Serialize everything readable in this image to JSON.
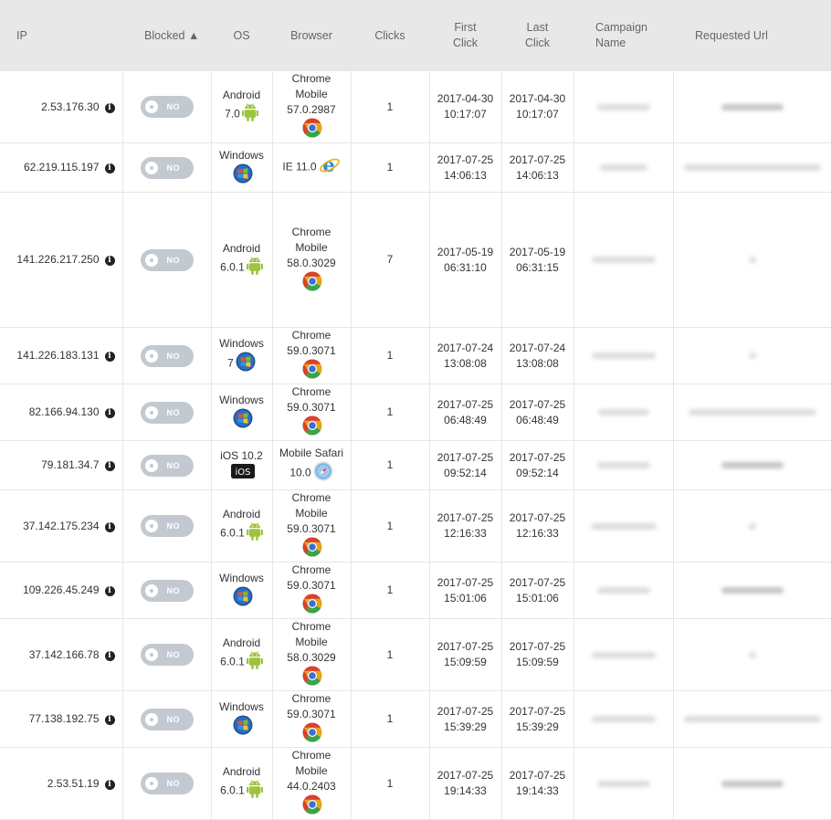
{
  "headers": {
    "ip": "IP",
    "blocked": "Blocked ▲",
    "os": "OS",
    "browser": "Browser",
    "clicks": "Clicks",
    "first_click": "First Click",
    "last_click": "Last Click",
    "campaign_name": "Campaign Name",
    "requested_url": "Requested Url"
  },
  "toggle_label": "NO",
  "info_icon_glyph": "i",
  "rows": [
    {
      "ip": "2.53.176.30",
      "os_name": "Android",
      "os_version": "7.0",
      "os_icon": "android-icon",
      "browser_name": "Chrome Mobile",
      "browser_version": "57.0.2987",
      "browser_icon": "chrome-icon",
      "clicks": "1",
      "first_date": "2017-04-30",
      "first_time": "10:17:07",
      "last_date": "2017-04-30",
      "last_time": "10:17:07"
    },
    {
      "ip": "62.219.115.197",
      "os_name": "Windows",
      "os_version": "",
      "os_icon": "windows-icon",
      "browser_name": "IE 11.0",
      "browser_version": "",
      "browser_icon": "ie-icon",
      "clicks": "1",
      "first_date": "2017-07-25",
      "first_time": "14:06:13",
      "last_date": "2017-07-25",
      "last_time": "14:06:13"
    },
    {
      "ip": "141.226.217.250",
      "os_name": "Android",
      "os_version": "6.0.1",
      "os_icon": "android-icon",
      "browser_name": "Chrome Mobile",
      "browser_version": "58.0.3029",
      "browser_icon": "chrome-icon",
      "clicks": "7",
      "first_date": "2017-05-19",
      "first_time": "06:31:10",
      "last_date": "2017-05-19",
      "last_time": "06:31:15"
    },
    {
      "ip": "141.226.183.131",
      "os_name": "Windows",
      "os_version": "7",
      "os_icon": "windows-icon",
      "browser_name": "Chrome",
      "browser_version": "59.0.3071",
      "browser_icon": "chrome-icon",
      "clicks": "1",
      "first_date": "2017-07-24",
      "first_time": "13:08:08",
      "last_date": "2017-07-24",
      "last_time": "13:08:08"
    },
    {
      "ip": "82.166.94.130",
      "os_name": "Windows",
      "os_version": "",
      "os_icon": "windows-icon",
      "browser_name": "Chrome",
      "browser_version": "59.0.3071",
      "browser_icon": "chrome-icon",
      "clicks": "1",
      "first_date": "2017-07-25",
      "first_time": "06:48:49",
      "last_date": "2017-07-25",
      "last_time": "06:48:49"
    },
    {
      "ip": "79.181.34.7",
      "os_name": "iOS 10.2",
      "os_version": "",
      "os_icon": "ios-icon",
      "browser_name": "Mobile Safari",
      "browser_version": "10.0",
      "browser_icon": "safari-icon",
      "clicks": "1",
      "first_date": "2017-07-25",
      "first_time": "09:52:14",
      "last_date": "2017-07-25",
      "last_time": "09:52:14"
    },
    {
      "ip": "37.142.175.234",
      "os_name": "Android",
      "os_version": "6.0.1",
      "os_icon": "android-icon",
      "browser_name": "Chrome Mobile",
      "browser_version": "59.0.3071",
      "browser_icon": "chrome-icon",
      "clicks": "1",
      "first_date": "2017-07-25",
      "first_time": "12:16:33",
      "last_date": "2017-07-25",
      "last_time": "12:16:33"
    },
    {
      "ip": "109.226.45.249",
      "os_name": "Windows",
      "os_version": "",
      "os_icon": "windows-icon",
      "browser_name": "Chrome",
      "browser_version": "59.0.3071",
      "browser_icon": "chrome-icon",
      "clicks": "1",
      "first_date": "2017-07-25",
      "first_time": "15:01:06",
      "last_date": "2017-07-25",
      "last_time": "15:01:06"
    },
    {
      "ip": "37.142.166.78",
      "os_name": "Android",
      "os_version": "6.0.1",
      "os_icon": "android-icon",
      "browser_name": "Chrome Mobile",
      "browser_version": "58.0.3029",
      "browser_icon": "chrome-icon",
      "clicks": "1",
      "first_date": "2017-07-25",
      "first_time": "15:09:59",
      "last_date": "2017-07-25",
      "last_time": "15:09:59"
    },
    {
      "ip": "77.138.192.75",
      "os_name": "Windows",
      "os_version": "",
      "os_icon": "windows-icon",
      "browser_name": "Chrome",
      "browser_version": "59.0.3071",
      "browser_icon": "chrome-icon",
      "clicks": "1",
      "first_date": "2017-07-25",
      "first_time": "15:39:29",
      "last_date": "2017-07-25",
      "last_time": "15:39:29"
    },
    {
      "ip": "2.53.51.19",
      "os_name": "Android",
      "os_version": "6.0.1",
      "os_icon": "android-icon",
      "browser_name": "Chrome Mobile",
      "browser_version": "44.0.2403",
      "browser_icon": "chrome-icon",
      "clicks": "1",
      "first_date": "2017-07-25",
      "first_time": "19:14:33",
      "last_date": "2017-07-25",
      "last_time": "19:14:33"
    }
  ],
  "colors": {
    "header_bg": "#e8e8e8",
    "toggle_off": "#c3c9d0",
    "android_green": "#9bc53d",
    "windows_blue": "#1f6fd1"
  }
}
